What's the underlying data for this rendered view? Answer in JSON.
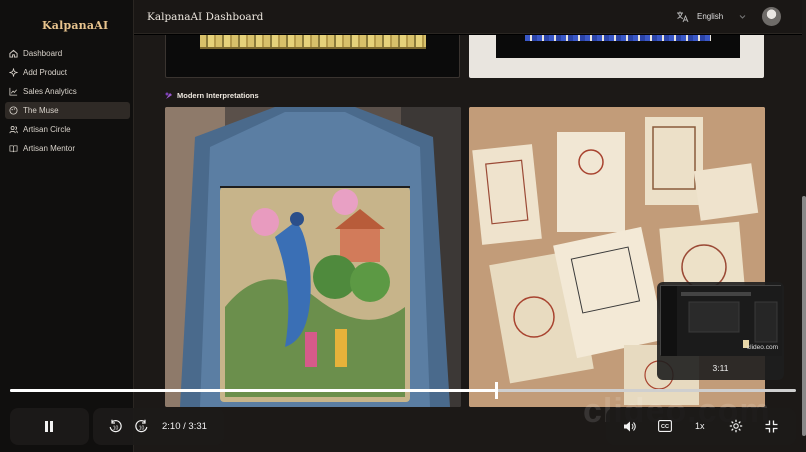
{
  "sidebar": {
    "brand": "KalpanaAI",
    "items": [
      {
        "label": "Dashboard",
        "icon": "home-icon"
      },
      {
        "label": "Add Product",
        "icon": "sparkle-icon"
      },
      {
        "label": "Sales Analytics",
        "icon": "chart-line-icon"
      },
      {
        "label": "The Muse",
        "icon": "palette-icon",
        "active": true
      },
      {
        "label": "Artisan Circle",
        "icon": "users-icon"
      },
      {
        "label": "Artisan Mentor",
        "icon": "book-icon"
      }
    ]
  },
  "header": {
    "title": "KalpanaAI Dashboard",
    "language": "English"
  },
  "main": {
    "section_title": "Modern Interpretations",
    "cards": [
      {
        "name": "denim-jacket-image",
        "icon": "image"
      },
      {
        "name": "stationery-set-image",
        "icon": "image"
      }
    ]
  },
  "player": {
    "current_time": "2:10",
    "duration": "/ 3:31",
    "progress": 0.62,
    "preview_time": "3:11",
    "preview_watermark": "clideo.com",
    "speed": "1x",
    "watermark": "clideo.com"
  },
  "colors": {
    "brand": "#e8c48e",
    "sidebar_bg": "#100f0e",
    "content_bg": "#1c1917",
    "active_item": "#2f2a26"
  }
}
